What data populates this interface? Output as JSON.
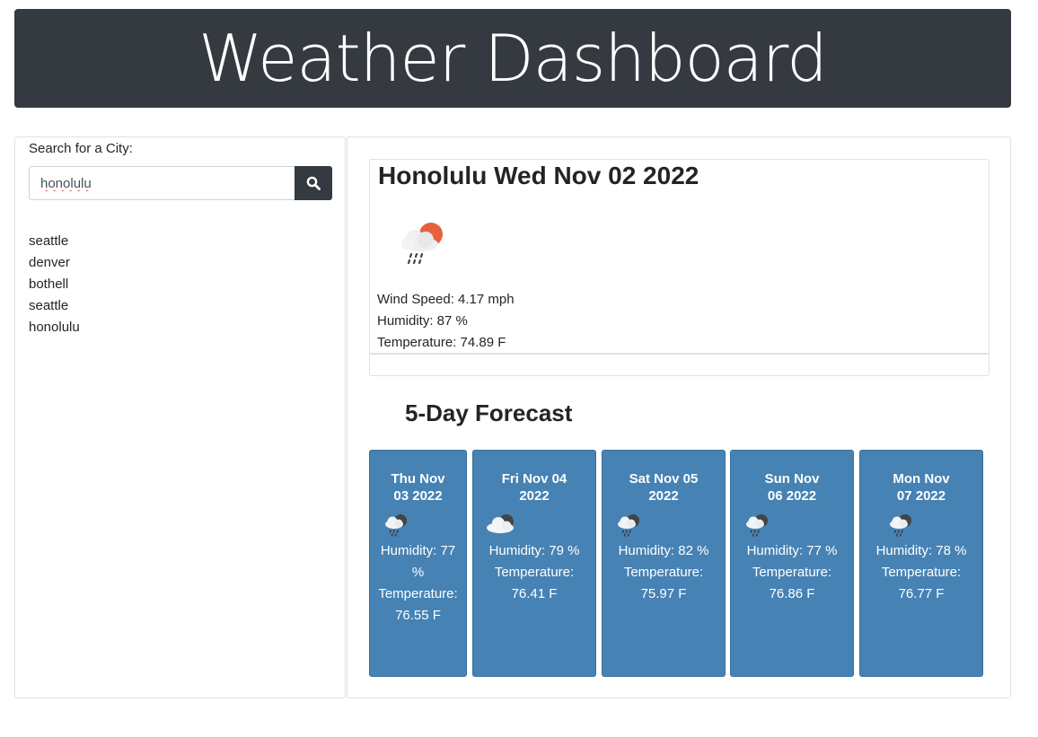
{
  "header": {
    "title": "Weather Dashboard"
  },
  "search": {
    "label": "Search for a City:",
    "value": "honolulu",
    "button_icon": "search-icon"
  },
  "history": [
    "seattle",
    "denver",
    "bothell",
    "seattle",
    "honolulu"
  ],
  "current": {
    "title": "Honolulu Wed Nov 02 2022",
    "icon": "sun-cloud-rain-icon",
    "wind": "Wind Speed: 4.17 mph",
    "humidity": "Humidity: 87 %",
    "temperature": "Temperature: 74.89 F"
  },
  "forecast": {
    "title": "5-Day Forecast",
    "days": [
      {
        "date": "Thu Nov 03 2022",
        "icon": "rain-cloud-icon",
        "humidity": "Humidity: 77 %",
        "temperature": "Temperature: 76.55 F"
      },
      {
        "date": "Fri Nov 04 2022",
        "icon": "cloud-icon",
        "humidity": "Humidity: 79 %",
        "temperature": "Temperature: 76.41 F"
      },
      {
        "date": "Sat Nov 05 2022",
        "icon": "rain-cloud-icon",
        "humidity": "Humidity: 82 %",
        "temperature": "Temperature: 75.97 F"
      },
      {
        "date": "Sun Nov 06 2022",
        "icon": "rain-cloud-icon",
        "humidity": "Humidity: 77 %",
        "temperature": "Temperature: 76.86 F"
      },
      {
        "date": "Mon Nov 07 2022",
        "icon": "rain-cloud-icon",
        "humidity": "Humidity: 78 %",
        "temperature": "Temperature: 76.77 F"
      }
    ]
  },
  "colors": {
    "header_bg": "#343a40",
    "card_bg": "#4682b4",
    "sun": "#e8613c"
  }
}
